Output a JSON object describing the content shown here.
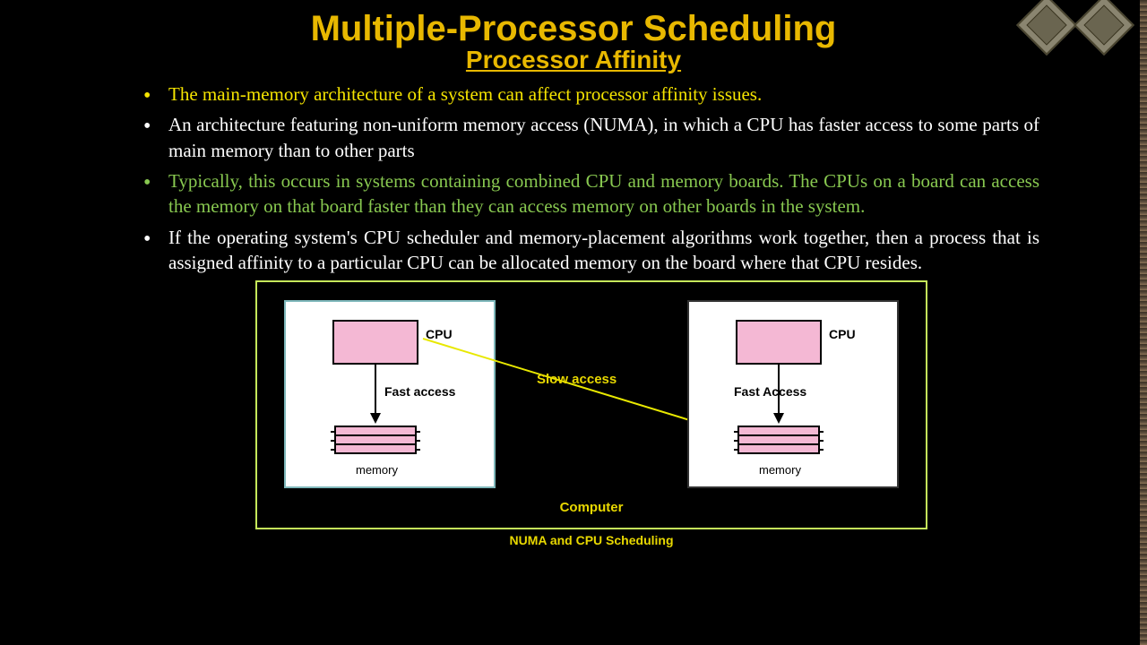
{
  "title": "Multiple-Processor Scheduling",
  "subtitle": "Processor Affinity",
  "bullets": [
    "The main-memory architecture of a system can affect processor affinity issues.",
    "An architecture featuring non-uniform memory access (NUMA), in which a CPU has faster access to some parts of main memory than to other parts",
    "Typically, this occurs in systems containing combined CPU and memory boards. The CPUs on a board can access the memory on that board faster than they can access memory on other boards in the system.",
    "If the operating system's CPU scheduler and memory-placement algorithms work together, then a process that is assigned affinity to a particular CPU can be allocated memory on the board where that CPU resides."
  ],
  "diagram": {
    "cpu_label": "CPU",
    "fast_label_left": "Fast access",
    "fast_label_right": "Fast Access",
    "memory_label": "memory",
    "slow_label": "Slow access",
    "computer_label": "Computer",
    "caption": "NUMA and CPU Scheduling"
  }
}
